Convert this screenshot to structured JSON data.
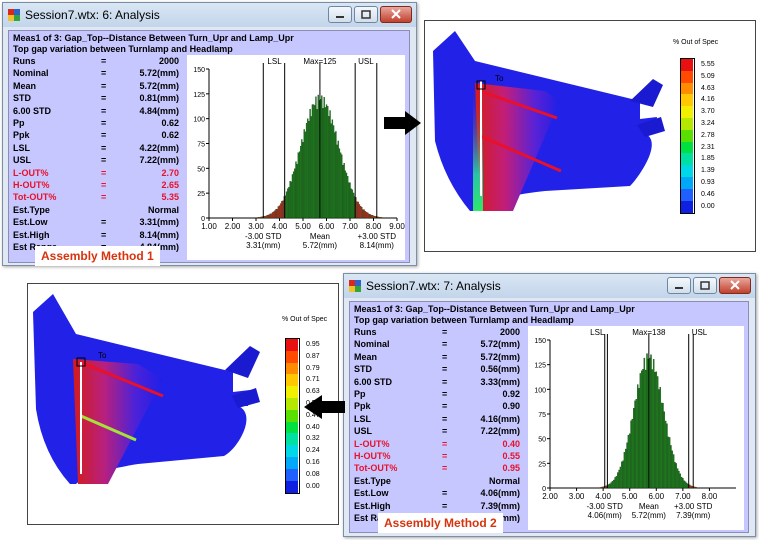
{
  "colors": {
    "panel_bg": "#c7c7ff",
    "red_text": "#e8102a",
    "caption_text": "#d6330e",
    "hist_bar": "#1b7f1b",
    "hist_tail": "#d92020",
    "part_blue": "#1f1fe6"
  },
  "window1": {
    "title": "Session7.wtx: 6: Analysis",
    "caption": "Assembly Method 1",
    "header_line1": "Meas1 of 3: Gap_Top--Distance Between Turn_Upr and Lamp_Upr",
    "header_line2": "Top gap variation between Turnlamp and Headlamp",
    "stats": [
      {
        "label": "Runs",
        "eq": "=",
        "value": "2000",
        "red": false
      },
      {
        "label": "Nominal",
        "eq": "=",
        "value": "5.72(mm)",
        "red": false
      },
      {
        "label": "Mean",
        "eq": "=",
        "value": "5.72(mm)",
        "red": false
      },
      {
        "label": "STD",
        "eq": "=",
        "value": "0.81(mm)",
        "red": false
      },
      {
        "label": "6.00 STD",
        "eq": "=",
        "value": "4.84(mm)",
        "red": false
      },
      {
        "label": "Pp",
        "eq": "=",
        "value": "0.62",
        "red": false
      },
      {
        "label": "Ppk",
        "eq": "=",
        "value": "0.62",
        "red": false
      },
      {
        "label": "LSL",
        "eq": "=",
        "value": "4.22(mm)",
        "red": false
      },
      {
        "label": "USL",
        "eq": "=",
        "value": "7.22(mm)",
        "red": false
      },
      {
        "label": "L-OUT%",
        "eq": "=",
        "value": "2.70",
        "red": true
      },
      {
        "label": "H-OUT%",
        "eq": "=",
        "value": "2.65",
        "red": true
      },
      {
        "label": "Tot-OUT%",
        "eq": "=",
        "value": "5.35",
        "red": true
      },
      {
        "label": "Est.Type",
        "eq": "",
        "value": "Normal",
        "red": false
      },
      {
        "label": "Est.Low",
        "eq": "=",
        "value": "3.31(mm)",
        "red": false
      },
      {
        "label": "Est.High",
        "eq": "=",
        "value": "8.14(mm)",
        "red": false
      },
      {
        "label": "Est Range",
        "eq": "=",
        "value": "4.84(mm)",
        "red": false
      }
    ],
    "chart_labels": {
      "lsl": "LSL",
      "max": "Max=125",
      "usl": "USL",
      "minus3": "-3.00 STD",
      "mean": "Mean",
      "plus3": "+3.00 STD",
      "low_val": "3.31(mm)",
      "mean_val": "5.72(mm)",
      "high_val": "8.14(mm)"
    }
  },
  "window2": {
    "title": "Session7.wtx: 7: Analysis",
    "caption": "Assembly Method 2",
    "header_line1": "Meas1 of 3: Gap_Top--Distance Between Turn_Upr and Lamp_Upr",
    "header_line2": "Top gap variation between Turnlamp and Headlamp",
    "stats": [
      {
        "label": "Runs",
        "eq": "=",
        "value": "2000",
        "red": false
      },
      {
        "label": "Nominal",
        "eq": "=",
        "value": "5.72(mm)",
        "red": false
      },
      {
        "label": "Mean",
        "eq": "=",
        "value": "5.72(mm)",
        "red": false
      },
      {
        "label": "STD",
        "eq": "=",
        "value": "0.56(mm)",
        "red": false
      },
      {
        "label": "6.00 STD",
        "eq": "=",
        "value": "3.33(mm)",
        "red": false
      },
      {
        "label": "Pp",
        "eq": "=",
        "value": "0.92",
        "red": false
      },
      {
        "label": "Ppk",
        "eq": "=",
        "value": "0.90",
        "red": false
      },
      {
        "label": "LSL",
        "eq": "=",
        "value": "4.16(mm)",
        "red": false
      },
      {
        "label": "USL",
        "eq": "=",
        "value": "7.22(mm)",
        "red": false
      },
      {
        "label": "L-OUT%",
        "eq": "=",
        "value": "0.40",
        "red": true
      },
      {
        "label": "H-OUT%",
        "eq": "=",
        "value": "0.55",
        "red": true
      },
      {
        "label": "Tot-OUT%",
        "eq": "=",
        "value": "0.95",
        "red": true
      },
      {
        "label": "Est.Type",
        "eq": "",
        "value": "Normal",
        "red": false
      },
      {
        "label": "Est.Low",
        "eq": "=",
        "value": "4.06(mm)",
        "red": false
      },
      {
        "label": "Est.High",
        "eq": "=",
        "value": "7.39(mm)",
        "red": false
      },
      {
        "label": "Est Range",
        "eq": "=",
        "value": "3.33(mm)",
        "red": false
      }
    ],
    "chart_labels": {
      "lsl": "LSL",
      "max": "Max=138",
      "usl": "USL",
      "minus3": "-3.00 STD",
      "mean": "Mean",
      "plus3": "+3.00 STD",
      "low_val": "4.06(mm)",
      "mean_val": "5.72(mm)",
      "high_val": "7.39(mm)"
    }
  },
  "view1": {
    "legend_title": "% Out of Spec",
    "legend_values": [
      "5.55",
      "5.09",
      "4.63",
      "4.16",
      "3.70",
      "3.24",
      "2.78",
      "2.31",
      "1.85",
      "1.39",
      "0.93",
      "0.46",
      "0.00"
    ],
    "part_label": "To"
  },
  "view2": {
    "legend_title": "% Out of Spec",
    "legend_values": [
      "0.95",
      "0.87",
      "0.79",
      "0.71",
      "0.63",
      "0.55",
      "0.47",
      "0.40",
      "0.32",
      "0.24",
      "0.16",
      "0.08",
      "0.00"
    ],
    "part_label": "To"
  },
  "chart_data": [
    {
      "type": "bar",
      "title": "",
      "xlabel": "",
      "ylabel": "",
      "xlim": [
        1.0,
        9.0
      ],
      "ylim": [
        0,
        150
      ],
      "xticks": [
        "1.00",
        "2.00",
        "3.00",
        "4.00",
        "5.00",
        "6.00",
        "7.00",
        "8.00",
        "9.00"
      ],
      "yticks": [
        "0",
        "25",
        "50",
        "75",
        "100",
        "125",
        "150"
      ],
      "mean": 5.72,
      "std": 0.81,
      "max_count": 125,
      "lsl": 4.22,
      "usl": 7.22,
      "est_low": 3.31,
      "est_high": 8.14
    },
    {
      "type": "bar",
      "title": "",
      "xlabel": "",
      "ylabel": "",
      "xlim": [
        2.0,
        9.0
      ],
      "ylim": [
        0,
        150
      ],
      "xticks": [
        "2.00",
        "3.00",
        "4.00",
        "5.00",
        "6.00",
        "7.00",
        "8.00"
      ],
      "yticks": [
        "0",
        "25",
        "50",
        "75",
        "100",
        "125",
        "150"
      ],
      "mean": 5.72,
      "std": 0.56,
      "max_count": 138,
      "lsl": 4.16,
      "usl": 7.22,
      "est_low": 4.06,
      "est_high": 7.39
    }
  ]
}
